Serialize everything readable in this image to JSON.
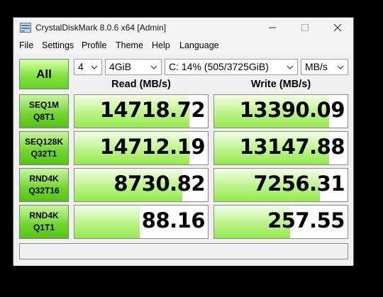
{
  "window": {
    "title": "CrystalDiskMark 8.0.6 x64 [Admin]"
  },
  "menu": [
    "File",
    "Settings",
    "Profile",
    "Theme",
    "Help",
    "Language"
  ],
  "controls": {
    "all_label": "All",
    "count": "4",
    "size": "4GiB",
    "drive": "C: 14% (505/3725GiB)",
    "unit": "MB/s"
  },
  "headers": {
    "read": "Read (MB/s)",
    "write": "Write (MB/s)"
  },
  "tests": [
    {
      "line1": "SEQ1M",
      "line2": "Q8T1",
      "read": "14718.72",
      "write": "13390.09",
      "read_fill": 0.86,
      "write_fill": 0.86
    },
    {
      "line1": "SEQ128K",
      "line2": "Q32T1",
      "read": "14712.19",
      "write": "13147.88",
      "read_fill": 0.86,
      "write_fill": 0.86
    },
    {
      "line1": "RND4K",
      "line2": "Q32T16",
      "read": "8730.82",
      "write": "7256.31",
      "read_fill": 0.81,
      "write_fill": 0.79
    },
    {
      "line1": "RND4K",
      "line2": "Q1T1",
      "read": "88.16",
      "write": "257.55",
      "read_fill": 0.49,
      "write_fill": 0.57
    }
  ],
  "comment": "",
  "colors": {
    "bar_green": "#93ea48",
    "label_green": "#6fd52c",
    "background": "#f0f0f0"
  },
  "icons": [
    "app-icon",
    "minimize-icon",
    "maximize-icon",
    "close-icon",
    "chevron-down-icon"
  ]
}
